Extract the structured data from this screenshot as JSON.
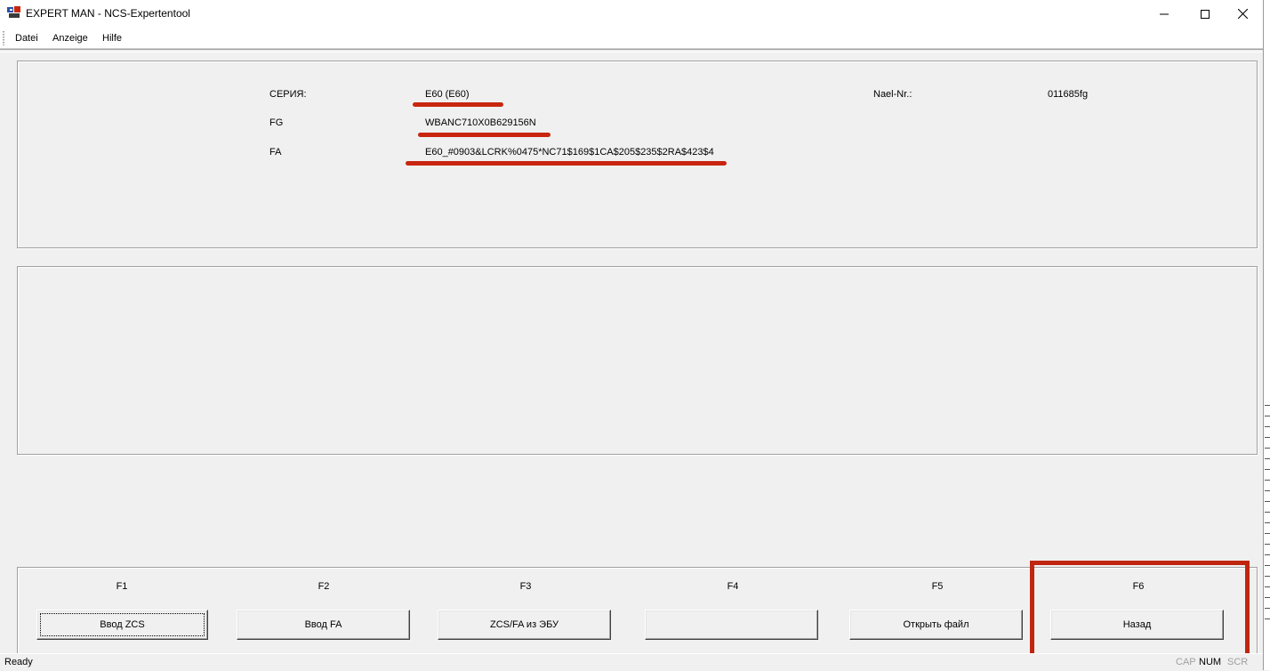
{
  "window": {
    "title": "EXPERT  MAN - NCS-Expertentool",
    "icon": "app-logo-icon",
    "controls": [
      "minimize-icon",
      "maximize-icon",
      "close-icon"
    ]
  },
  "menu": {
    "items": [
      {
        "label": "Datei"
      },
      {
        "label": "Anzeige"
      },
      {
        "label": "Hilfe"
      }
    ]
  },
  "info": {
    "series_label": "СЕРИЯ:",
    "series_value": "E60 (E60)",
    "fg_label": "FG",
    "fg_value": "WBANC710X0B629156N",
    "fa_label": "FA",
    "fa_value": "E60_#0903&LCRK%0475*NC71$169$1CA$205$235$2RA$423$4",
    "nael_label": "Nael-Nr.:",
    "nael_value": "011685fg"
  },
  "fkeys": [
    {
      "key": "F1",
      "label": "Ввод ZCS"
    },
    {
      "key": "F2",
      "label": "Ввод FA"
    },
    {
      "key": "F3",
      "label": "ZCS/FA из ЭБУ"
    },
    {
      "key": "F4",
      "label": ""
    },
    {
      "key": "F5",
      "label": "Открыть файл"
    },
    {
      "key": "F6",
      "label": "Назад"
    }
  ],
  "status": {
    "text": "Ready",
    "cap": "CAP",
    "num": "NUM",
    "scrl": "SCR"
  },
  "colors": {
    "annotation": "#c8260f",
    "background": "#f0f0f0"
  }
}
